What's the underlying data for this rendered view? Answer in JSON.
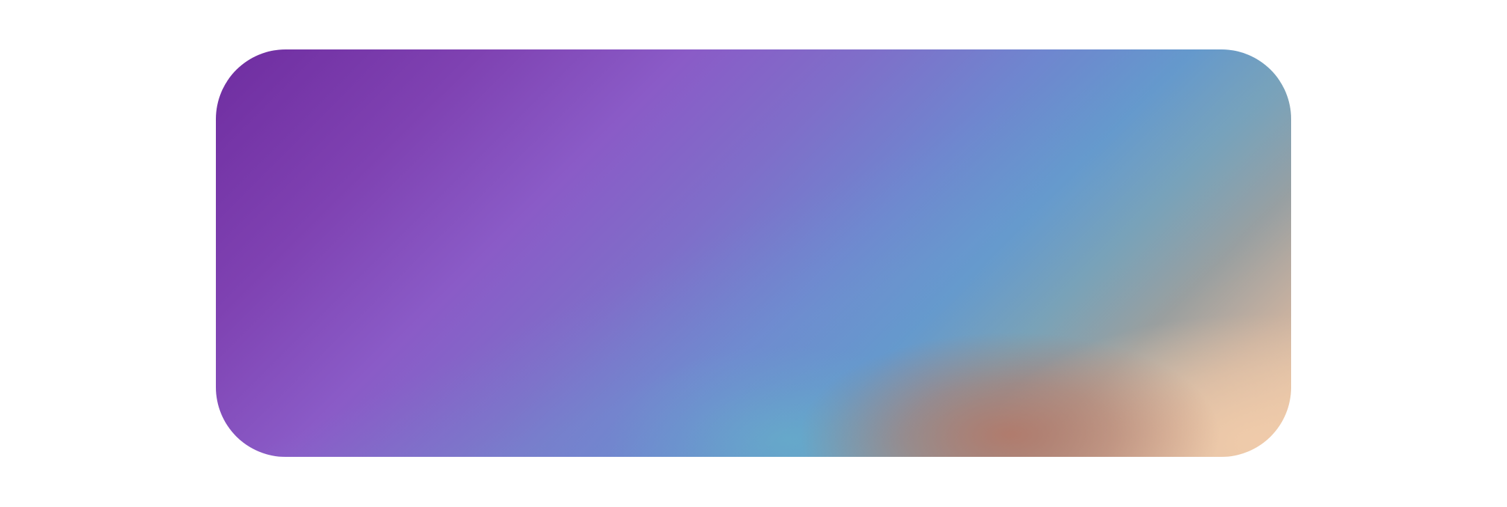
{
  "card": {
    "colors": {
      "top_left": "#6f2da0",
      "mid_purple": "#8a5bc7",
      "mid_blue": "#6f86cf",
      "teal": "#66b2c8",
      "brown": "#b27868",
      "peach": "#efcaa9"
    }
  }
}
